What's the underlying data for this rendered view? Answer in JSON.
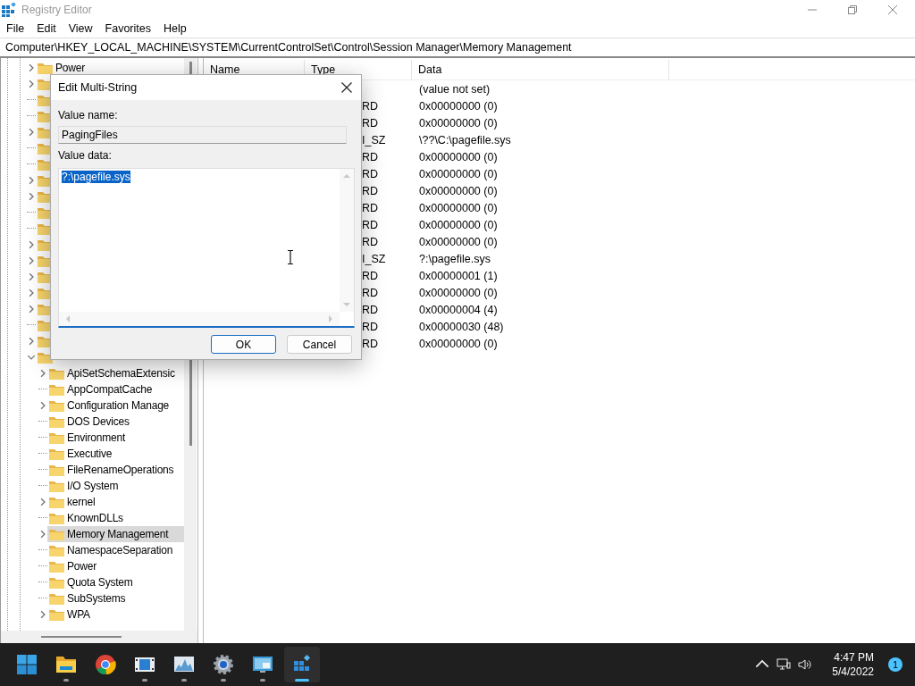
{
  "window": {
    "title": "Registry Editor",
    "active": false
  },
  "menu": [
    "File",
    "Edit",
    "View",
    "Favorites",
    "Help"
  ],
  "address": "Computer\\HKEY_LOCAL_MACHINE\\SYSTEM\\CurrentControlSet\\Control\\Session Manager\\Memory Management",
  "tree": [
    {
      "label": "Power",
      "expandable": true,
      "expanded": false,
      "selected": false
    },
    {
      "expandable": true,
      "expanded": false,
      "selected": false
    },
    {
      "expandable": false,
      "selected": false
    },
    {
      "expandable": false,
      "selected": false
    },
    {
      "expandable": true,
      "expanded": false,
      "selected": false
    },
    {
      "expandable": false,
      "selected": false
    },
    {
      "expandable": false,
      "selected": false
    },
    {
      "expandable": true,
      "expanded": false,
      "selected": false
    },
    {
      "expandable": true,
      "expanded": false,
      "selected": false
    },
    {
      "expandable": false,
      "selected": false
    },
    {
      "expandable": false,
      "selected": false
    },
    {
      "expandable": true,
      "expanded": false,
      "selected": false
    },
    {
      "expandable": true,
      "expanded": false,
      "selected": false
    },
    {
      "expandable": true,
      "expanded": false,
      "selected": false
    },
    {
      "expandable": true,
      "expanded": false,
      "selected": false
    },
    {
      "expandable": true,
      "expanded": false,
      "selected": false
    },
    {
      "expandable": false,
      "selected": false
    },
    {
      "expandable": true,
      "expanded": false,
      "selected": false
    },
    {
      "expandable": true,
      "expanded": true,
      "selected": false,
      "children": [
        {
          "label": "ApiSetSchemaExtensic",
          "expandable": true,
          "selected": false
        },
        {
          "label": "AppCompatCache",
          "expandable": false,
          "selected": false
        },
        {
          "label": "Configuration Manage",
          "expandable": true,
          "selected": false
        },
        {
          "label": "DOS Devices",
          "expandable": false,
          "selected": false
        },
        {
          "label": "Environment",
          "expandable": false,
          "selected": false
        },
        {
          "label": "Executive",
          "expandable": false,
          "selected": false
        },
        {
          "label": "FileRenameOperations",
          "expandable": false,
          "selected": false
        },
        {
          "label": "I/O System",
          "expandable": false,
          "selected": false
        },
        {
          "label": "kernel",
          "expandable": true,
          "selected": false
        },
        {
          "label": "KnownDLLs",
          "expandable": false,
          "selected": false
        },
        {
          "label": "Memory Management",
          "expandable": true,
          "selected": true
        },
        {
          "label": "NamespaceSeparation",
          "expandable": false,
          "selected": false
        },
        {
          "label": "Power",
          "expandable": false,
          "selected": false
        },
        {
          "label": "Quota System",
          "expandable": false,
          "selected": false
        },
        {
          "label": "SubSystems",
          "expandable": false,
          "selected": false
        },
        {
          "label": "WPA",
          "expandable": true,
          "selected": false
        }
      ]
    }
  ],
  "list": {
    "columns": [
      "Name",
      "Type",
      "Data"
    ],
    "rows": [
      {
        "data": "(value not set)"
      },
      {
        "type": "RD",
        "data": "0x00000000 (0)"
      },
      {
        "type": "RD",
        "data": "0x00000000 (0)"
      },
      {
        "type": "I_SZ",
        "data": "\\??\\C:\\pagefile.sys"
      },
      {
        "type": "RD",
        "data": "0x00000000 (0)"
      },
      {
        "type": "RD",
        "data": "0x00000000 (0)"
      },
      {
        "type": "RD",
        "data": "0x00000000 (0)"
      },
      {
        "type": "RD",
        "data": "0x00000000 (0)"
      },
      {
        "type": "RD",
        "data": "0x00000000 (0)"
      },
      {
        "type": "RD",
        "data": "0x00000000 (0)"
      },
      {
        "type": "I_SZ",
        "data": "?:\\pagefile.sys"
      },
      {
        "type": "RD",
        "data": "0x00000001 (1)"
      },
      {
        "type": "RD",
        "data": "0x00000000 (0)"
      },
      {
        "type": "RD",
        "data": "0x00000004 (4)"
      },
      {
        "type": "RD",
        "data": "0x00000030 (48)"
      },
      {
        "type": "RD",
        "data": "0x00000000 (0)"
      }
    ]
  },
  "dialog": {
    "title": "Edit Multi-String",
    "name_label": "Value name:",
    "name_value": "PagingFiles",
    "data_label": "Value data:",
    "data_value": "?:\\pagefile.sys",
    "data_selected": true,
    "buttons": [
      {
        "label": "OK",
        "default": true
      },
      {
        "label": "Cancel",
        "default": false
      }
    ]
  },
  "taskbar": {
    "apps": [
      {
        "kind": "start",
        "running": false,
        "active": false
      },
      {
        "kind": "folder",
        "running": true,
        "active": false
      },
      {
        "kind": "browser",
        "running": false,
        "active": false
      },
      {
        "kind": "media",
        "running": true,
        "active": false
      },
      {
        "kind": "chart",
        "running": true,
        "active": false
      },
      {
        "kind": "gear",
        "running": true,
        "active": false
      },
      {
        "kind": "remote",
        "running": true,
        "active": false
      },
      {
        "kind": "registry",
        "running": true,
        "active": true
      }
    ],
    "time": "4:47 PM",
    "date": "5/4/2022",
    "notifications": "1"
  }
}
